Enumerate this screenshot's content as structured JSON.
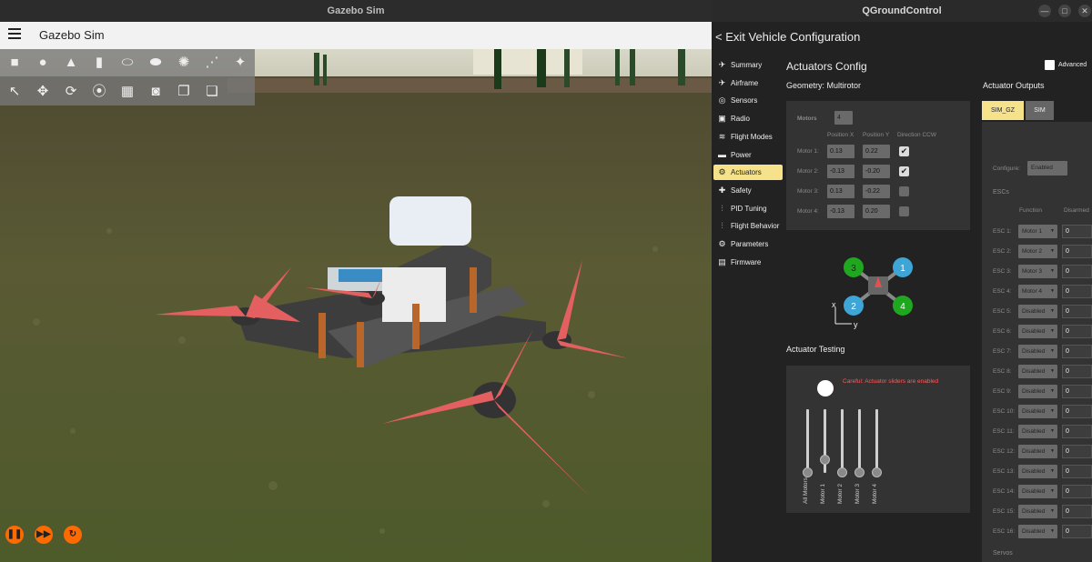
{
  "gazebo": {
    "window_title": "Gazebo Sim",
    "app_title": "Gazebo Sim",
    "toolbar_icons": [
      "box-icon",
      "sphere-icon",
      "cone-icon",
      "cylinder-icon",
      "capsule-icon",
      "ellipsoid-icon",
      "sun-icon",
      "directional-light-icon",
      "spot-light-icon",
      "select-icon",
      "translate-icon",
      "rotate-icon",
      "snap-icon",
      "grid-icon",
      "screenshot-icon",
      "copy-icon",
      "paste-icon"
    ],
    "playback": [
      "pause-icon",
      "step-icon",
      "reset-icon"
    ]
  },
  "qgc": {
    "window_title": "QGroundControl",
    "exit_label": "< Exit Vehicle Configuration",
    "sidebar": [
      {
        "label": "Summary",
        "icon": "plane-icon",
        "active": false
      },
      {
        "label": "Airframe",
        "icon": "airframe-icon",
        "active": false
      },
      {
        "label": "Sensors",
        "icon": "sensors-icon",
        "active": false
      },
      {
        "label": "Radio",
        "icon": "radio-icon",
        "active": false
      },
      {
        "label": "Flight Modes",
        "icon": "flight-modes-icon",
        "active": false
      },
      {
        "label": "Power",
        "icon": "power-icon",
        "active": false
      },
      {
        "label": "Actuators",
        "icon": "actuators-icon",
        "active": true
      },
      {
        "label": "Safety",
        "icon": "safety-icon",
        "active": false
      },
      {
        "label": "PID Tuning",
        "icon": "pid-tuning-icon",
        "active": false
      },
      {
        "label": "Flight Behavior",
        "icon": "flight-behavior-icon",
        "active": false
      },
      {
        "label": "Parameters",
        "icon": "parameters-icon",
        "active": false
      },
      {
        "label": "Firmware",
        "icon": "firmware-icon",
        "active": false
      }
    ],
    "config_title": "Actuators Config",
    "geometry": "Geometry: Multirotor",
    "advanced_label": "Advanced",
    "motors": {
      "label": "Motors",
      "count": "4",
      "col_pos_x": "Position X",
      "col_pos_y": "Position Y",
      "col_dir": "Direction CCW",
      "rows": [
        {
          "label": "Motor 1:",
          "x": "0.13",
          "y": "0.22",
          "ccw": true
        },
        {
          "label": "Motor 2:",
          "x": "-0.13",
          "y": "-0.20",
          "ccw": true
        },
        {
          "label": "Motor 3:",
          "x": "0.13",
          "y": "-0.22",
          "ccw": false
        },
        {
          "label": "Motor 4:",
          "x": "-0.13",
          "y": "0.20",
          "ccw": false
        }
      ]
    },
    "diagram": {
      "labels": [
        "3",
        "1",
        "2",
        "4"
      ],
      "axis_x": "x",
      "axis_y": "y"
    },
    "testing": {
      "title": "Actuator Testing",
      "warning": "Careful: Actuator sliders are enabled",
      "sliders": [
        {
          "label": "All Motors",
          "level": 0.0
        },
        {
          "label": "Motor 1",
          "level": 0.2
        },
        {
          "label": "Motor 2",
          "level": 0.0
        },
        {
          "label": "Motor 3",
          "level": 0.0
        },
        {
          "label": "Motor 4",
          "level": 0.0
        }
      ]
    },
    "outputs": {
      "title": "Actuator Outputs",
      "tabs": [
        "SIM_GZ",
        "SIM"
      ],
      "configure_label": "Configure:",
      "configure_value": "Enabled",
      "escs_label": "ESCs",
      "col_function": "Function",
      "col_disarmed": "Disarmed",
      "escs": [
        {
          "label": "ESC 1:",
          "func": "Motor 1",
          "disarmed": "0"
        },
        {
          "label": "ESC 2:",
          "func": "Motor 2",
          "disarmed": "0"
        },
        {
          "label": "ESC 3:",
          "func": "Motor 3",
          "disarmed": "0"
        },
        {
          "label": "ESC 4:",
          "func": "Motor 4",
          "disarmed": "0"
        },
        {
          "label": "ESC 5:",
          "func": "Disabled",
          "disarmed": "0"
        },
        {
          "label": "ESC 6:",
          "func": "Disabled",
          "disarmed": "0"
        },
        {
          "label": "ESC 7:",
          "func": "Disabled",
          "disarmed": "0"
        },
        {
          "label": "ESC 8:",
          "func": "Disabled",
          "disarmed": "0"
        },
        {
          "label": "ESC 9:",
          "func": "Disabled",
          "disarmed": "0"
        },
        {
          "label": "ESC 10:",
          "func": "Disabled",
          "disarmed": "0"
        },
        {
          "label": "ESC 11:",
          "func": "Disabled",
          "disarmed": "0"
        },
        {
          "label": "ESC 12:",
          "func": "Disabled",
          "disarmed": "0"
        },
        {
          "label": "ESC 13:",
          "func": "Disabled",
          "disarmed": "0"
        },
        {
          "label": "ESC 14:",
          "func": "Disabled",
          "disarmed": "0"
        },
        {
          "label": "ESC 15:",
          "func": "Disabled",
          "disarmed": "0"
        },
        {
          "label": "ESC 16:",
          "func": "Disabled",
          "disarmed": "0"
        }
      ],
      "servos_label": "Servos"
    },
    "colors": {
      "accent": "#f5e28a",
      "warning": "#ff5a5a",
      "motor_green": "#1fa81f",
      "motor_blue": "#3ea6d6"
    }
  }
}
